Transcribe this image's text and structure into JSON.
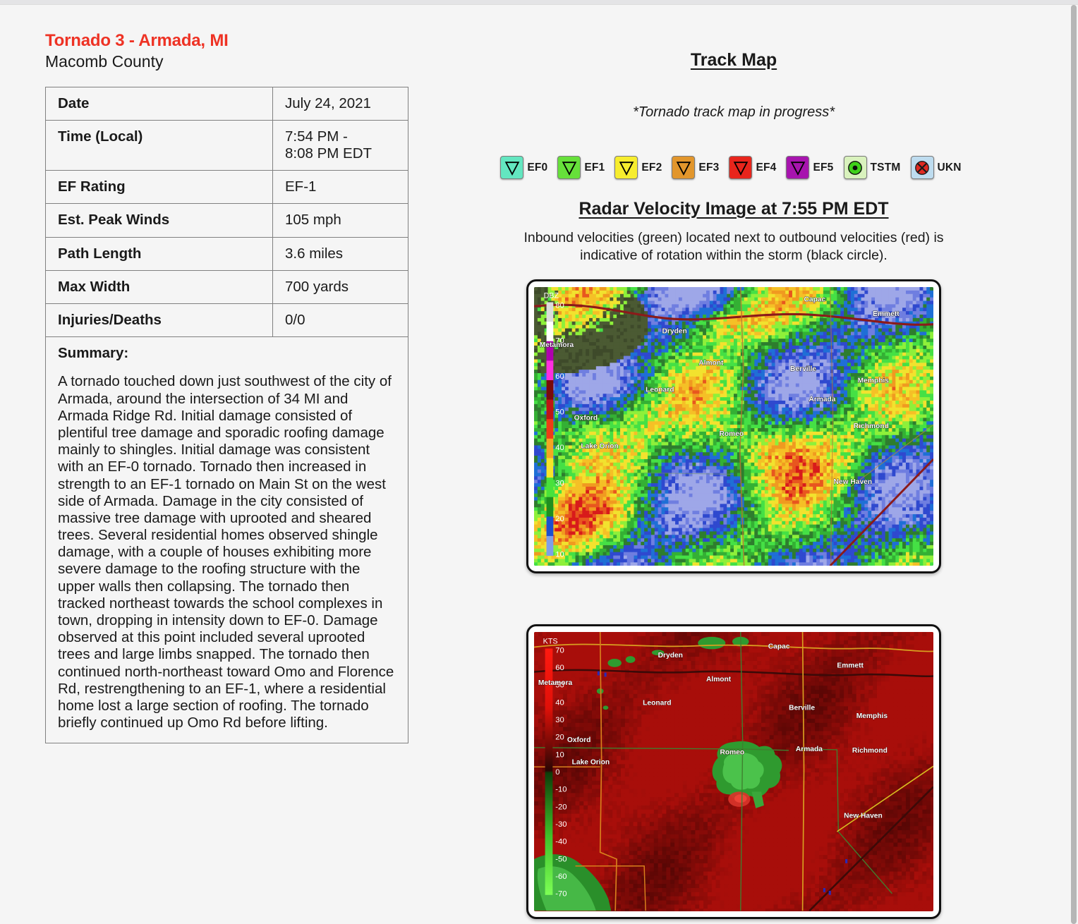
{
  "left": {
    "title": "Tornado 3 - Armada, MI",
    "county": "Macomb County",
    "title_color": "#ee3224",
    "facts": [
      {
        "key": "Date",
        "value": "July 24, 2021"
      },
      {
        "key": "Time (Local)",
        "value": "7:54 PM -\n8:08 PM EDT"
      },
      {
        "key": "EF Rating",
        "value": "EF-1"
      },
      {
        "key": "Est. Peak Winds",
        "value": "105 mph"
      },
      {
        "key": "Path Length",
        "value": "3.6 miles"
      },
      {
        "key": "Max Width",
        "value": "700 yards"
      },
      {
        "key": "Injuries/Deaths",
        "value": "0/0"
      }
    ],
    "summary_label": "Summary:",
    "summary_text": "A tornado touched down just southwest of the city of Armada, around the intersection of 34 MI and Armada Ridge Rd. Initial damage consisted of plentiful tree damage and sporadic roofing damage mainly to shingles. Initial damage was consistent with an EF-0 tornado. Tornado then increased in strength to an EF-1 tornado on Main St on the west side of Armada. Damage in the city consisted of massive tree damage with uprooted and sheared trees. Several residential homes observed shingle damage, with a couple of houses exhibiting more severe damage to the roofing structure with the upper walls then collapsing. The tornado then tracked northeast towards the school complexes in town, dropping in intensity down to EF-0. Damage observed at this point included several uprooted trees and large limbs snapped. The tornado then continued north-northeast toward Omo and Florence Rd, restrengthening to an EF-1, where a residential home lost a large section of roofing. The tornado briefly continued up Omo Rd before lifting."
  },
  "right": {
    "track_map_title": "Track Map",
    "track_map_note": "*Tornado track map in progress*",
    "radar_title": "Radar Velocity Image at 7:55 PM EDT",
    "radar_caption": "Inbound velocities (green) located next to outbound velocities (red) is indicative of rotation within the storm (black circle)."
  },
  "legend": [
    {
      "label": "EF0",
      "icon": "triangle-down-icon",
      "fill": "#63e6c0",
      "box": "#63e6c0"
    },
    {
      "label": "EF1",
      "icon": "triangle-down-icon",
      "fill": "#66e03a",
      "box": "#66e03a"
    },
    {
      "label": "EF2",
      "icon": "triangle-down-icon",
      "fill": "#f7ed2e",
      "box": "#f7ed2e"
    },
    {
      "label": "EF3",
      "icon": "triangle-down-icon",
      "fill": "#e2962c",
      "box": "#e2962c"
    },
    {
      "label": "EF4",
      "icon": "triangle-down-icon",
      "fill": "#e8251c",
      "box": "#e8251c"
    },
    {
      "label": "EF5",
      "icon": "triangle-down-icon",
      "fill": "#a714ae",
      "box": "#a714ae"
    },
    {
      "label": "TSTM",
      "icon": "storm-dot-icon",
      "fill": "#3fd11a",
      "box": "#d9f2bd"
    },
    {
      "label": "UKN",
      "icon": "circle-x-icon",
      "fill": "#e02a22",
      "box": "#bedcef"
    }
  ],
  "radar_reflectivity": {
    "scale_label": "DBZ",
    "scale_ticks": [
      "80",
      "70",
      "60",
      "50",
      "40",
      "30",
      "20",
      "10"
    ],
    "cities": [
      "Capac",
      "Emmett",
      "Dryden",
      "Almont",
      "Berville",
      "Memphis",
      "Leonard",
      "Armada",
      "Oxford",
      "Romeo",
      "Richmond",
      "Lake Orion",
      "New Haven",
      "Metamora"
    ]
  },
  "radar_velocity": {
    "scale_label": "KTS",
    "scale_ticks": [
      "70",
      "60",
      "50",
      "40",
      "30",
      "20",
      "10",
      "0",
      "-10",
      "-20",
      "-30",
      "-40",
      "-50",
      "-60",
      "-70"
    ],
    "cities": [
      "Capac",
      "Emmett",
      "Dryden",
      "Almont",
      "Berville",
      "Memphis",
      "Leonard",
      "Armada",
      "Oxford",
      "Romeo",
      "Richmond",
      "Lake Orion",
      "New Haven",
      "Metamora"
    ]
  }
}
